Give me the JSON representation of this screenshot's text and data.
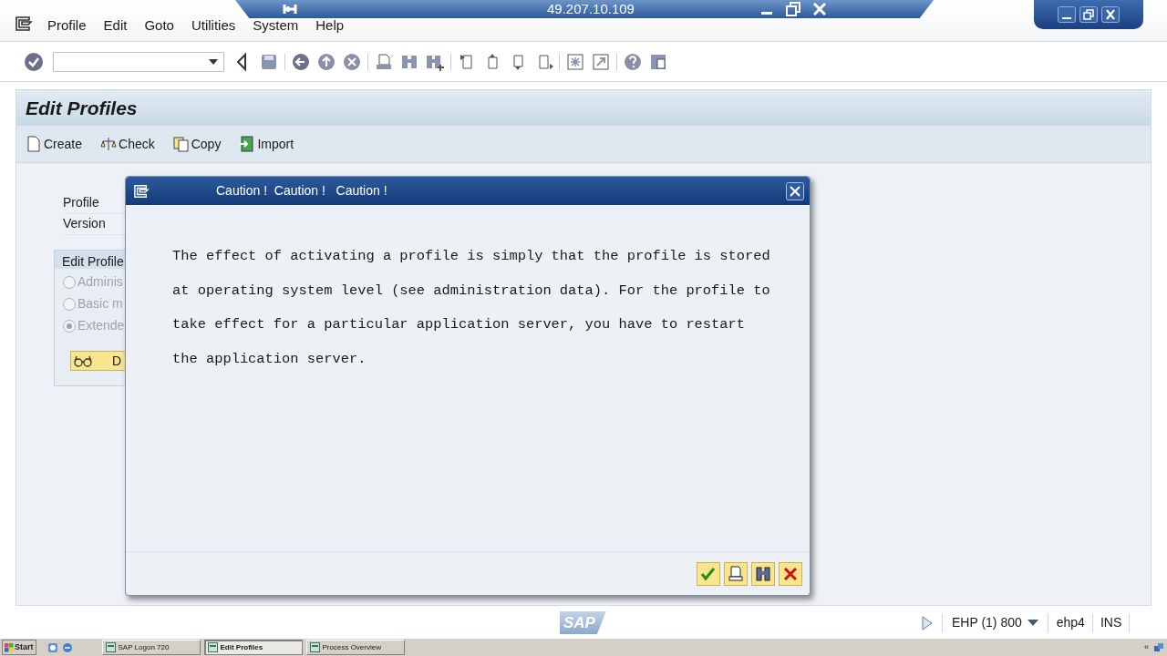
{
  "menu": [
    "Profile",
    "Edit",
    "Goto",
    "Utilities",
    "System",
    "Help"
  ],
  "connection_bar": {
    "title": "49.207.10.109"
  },
  "screen": {
    "title": "Edit Profiles",
    "actions": [
      {
        "kind": "create",
        "label": "Create"
      },
      {
        "kind": "check",
        "label": "Check"
      },
      {
        "kind": "copy",
        "label": "Copy"
      },
      {
        "kind": "import",
        "label": "Import"
      }
    ],
    "fields": [
      "Profile",
      "Version"
    ],
    "group": {
      "title": "Edit Profile",
      "options": [
        {
          "label": "Adminis",
          "selected": false
        },
        {
          "label": "Basic m",
          "selected": false
        },
        {
          "label": "Extende",
          "selected": true
        }
      ],
      "button": "D"
    }
  },
  "dialog": {
    "title": "Caution !  Caution !   Caution !",
    "message": "The effect of activating a profile is simply that the profile is stored at operating system level (see administration data). For the profile to take effect for a particular application server, you have to restart the application server.",
    "buttons": [
      {
        "kind": "ok"
      },
      {
        "kind": "print"
      },
      {
        "kind": "find"
      },
      {
        "kind": "cancel"
      }
    ]
  },
  "status_bar": {
    "logo": "SAP",
    "system": "EHP (1) 800",
    "client": "ehp4",
    "mode": "INS"
  },
  "taskbar": {
    "start": "Start",
    "tasks": [
      {
        "label": "SAP Logon 720",
        "selected": false
      },
      {
        "label": "Edit Profiles",
        "selected": true
      },
      {
        "label": "Process Overview",
        "selected": false
      }
    ],
    "tray": "«"
  }
}
